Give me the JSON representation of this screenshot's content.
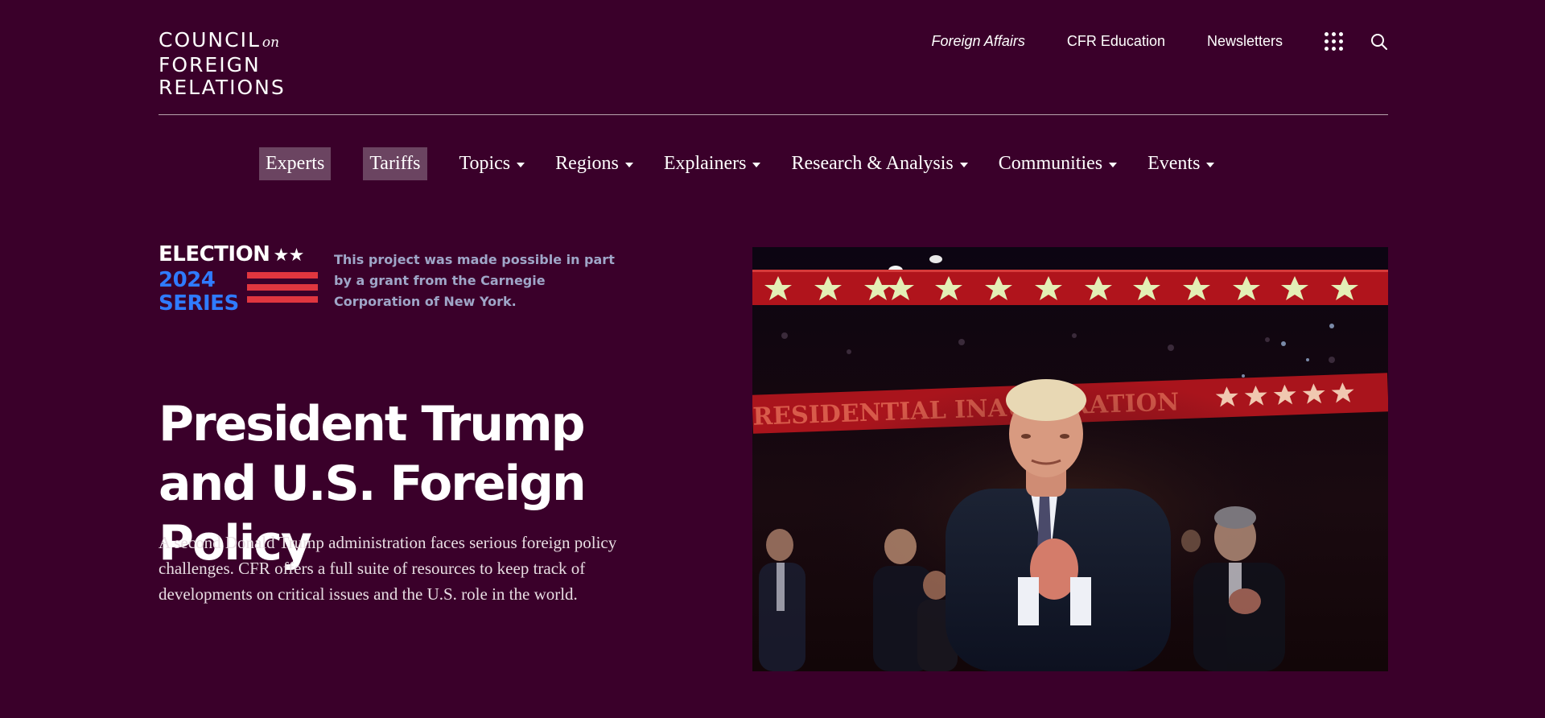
{
  "header": {
    "logo": {
      "line1": "COUNCIL",
      "on": "on",
      "line2": "FOREIGN",
      "line3": "RELATIONS"
    },
    "utility_links": [
      "Foreign Affairs",
      "CFR Education",
      "Newsletters"
    ],
    "icons": [
      "apps-grid-icon",
      "search-icon"
    ]
  },
  "nav": {
    "pills": [
      "Experts",
      "Tariffs"
    ],
    "dropdowns": [
      "Topics",
      "Regions",
      "Explainers",
      "Research & Analysis",
      "Communities",
      "Events"
    ]
  },
  "badge": {
    "top": "ELECTION",
    "stars": "★★",
    "year": "2024",
    "series": "SERIES",
    "note": "This project was made possible in part by a grant from the Carnegie Corporation of New York."
  },
  "hero": {
    "title": "President Trump and U.S. Foreign Policy",
    "description": "A second Donald Trump administration faces serious foreign policy challenges. CFR offers a full suite of resources to keep track of developments on critical issues and the U.S. role in the world."
  },
  "colors": {
    "background": "#3a002a",
    "pill": "#6b4461",
    "badge_blue": "#2f7bff",
    "badge_red": "#e0363f",
    "badge_note": "#9fa6c8"
  }
}
